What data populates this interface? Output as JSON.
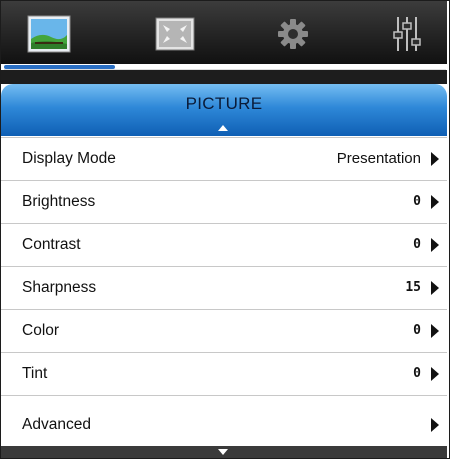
{
  "tabs": [
    {
      "icon": "picture-icon",
      "selected": true
    },
    {
      "icon": "screen-fit-icon",
      "selected": false
    },
    {
      "icon": "gear-icon",
      "selected": false
    },
    {
      "icon": "equalizer-icon",
      "selected": false
    }
  ],
  "menu": {
    "title": "PICTURE",
    "items": [
      {
        "label": "Display Mode",
        "value": "Presentation"
      },
      {
        "label": "Brightness",
        "value": "0"
      },
      {
        "label": "Contrast",
        "value": "0"
      },
      {
        "label": "Sharpness",
        "value": "15"
      },
      {
        "label": "Color",
        "value": "0"
      },
      {
        "label": "Tint",
        "value": "0"
      },
      {
        "label": "Advanced",
        "value": ""
      }
    ]
  },
  "progress": 0.25,
  "colors": {
    "accent": "#2e88d8",
    "header_dark": "#0f5fb4",
    "tabbar": "#2a2a2a",
    "progress": "#2a6fc4"
  }
}
